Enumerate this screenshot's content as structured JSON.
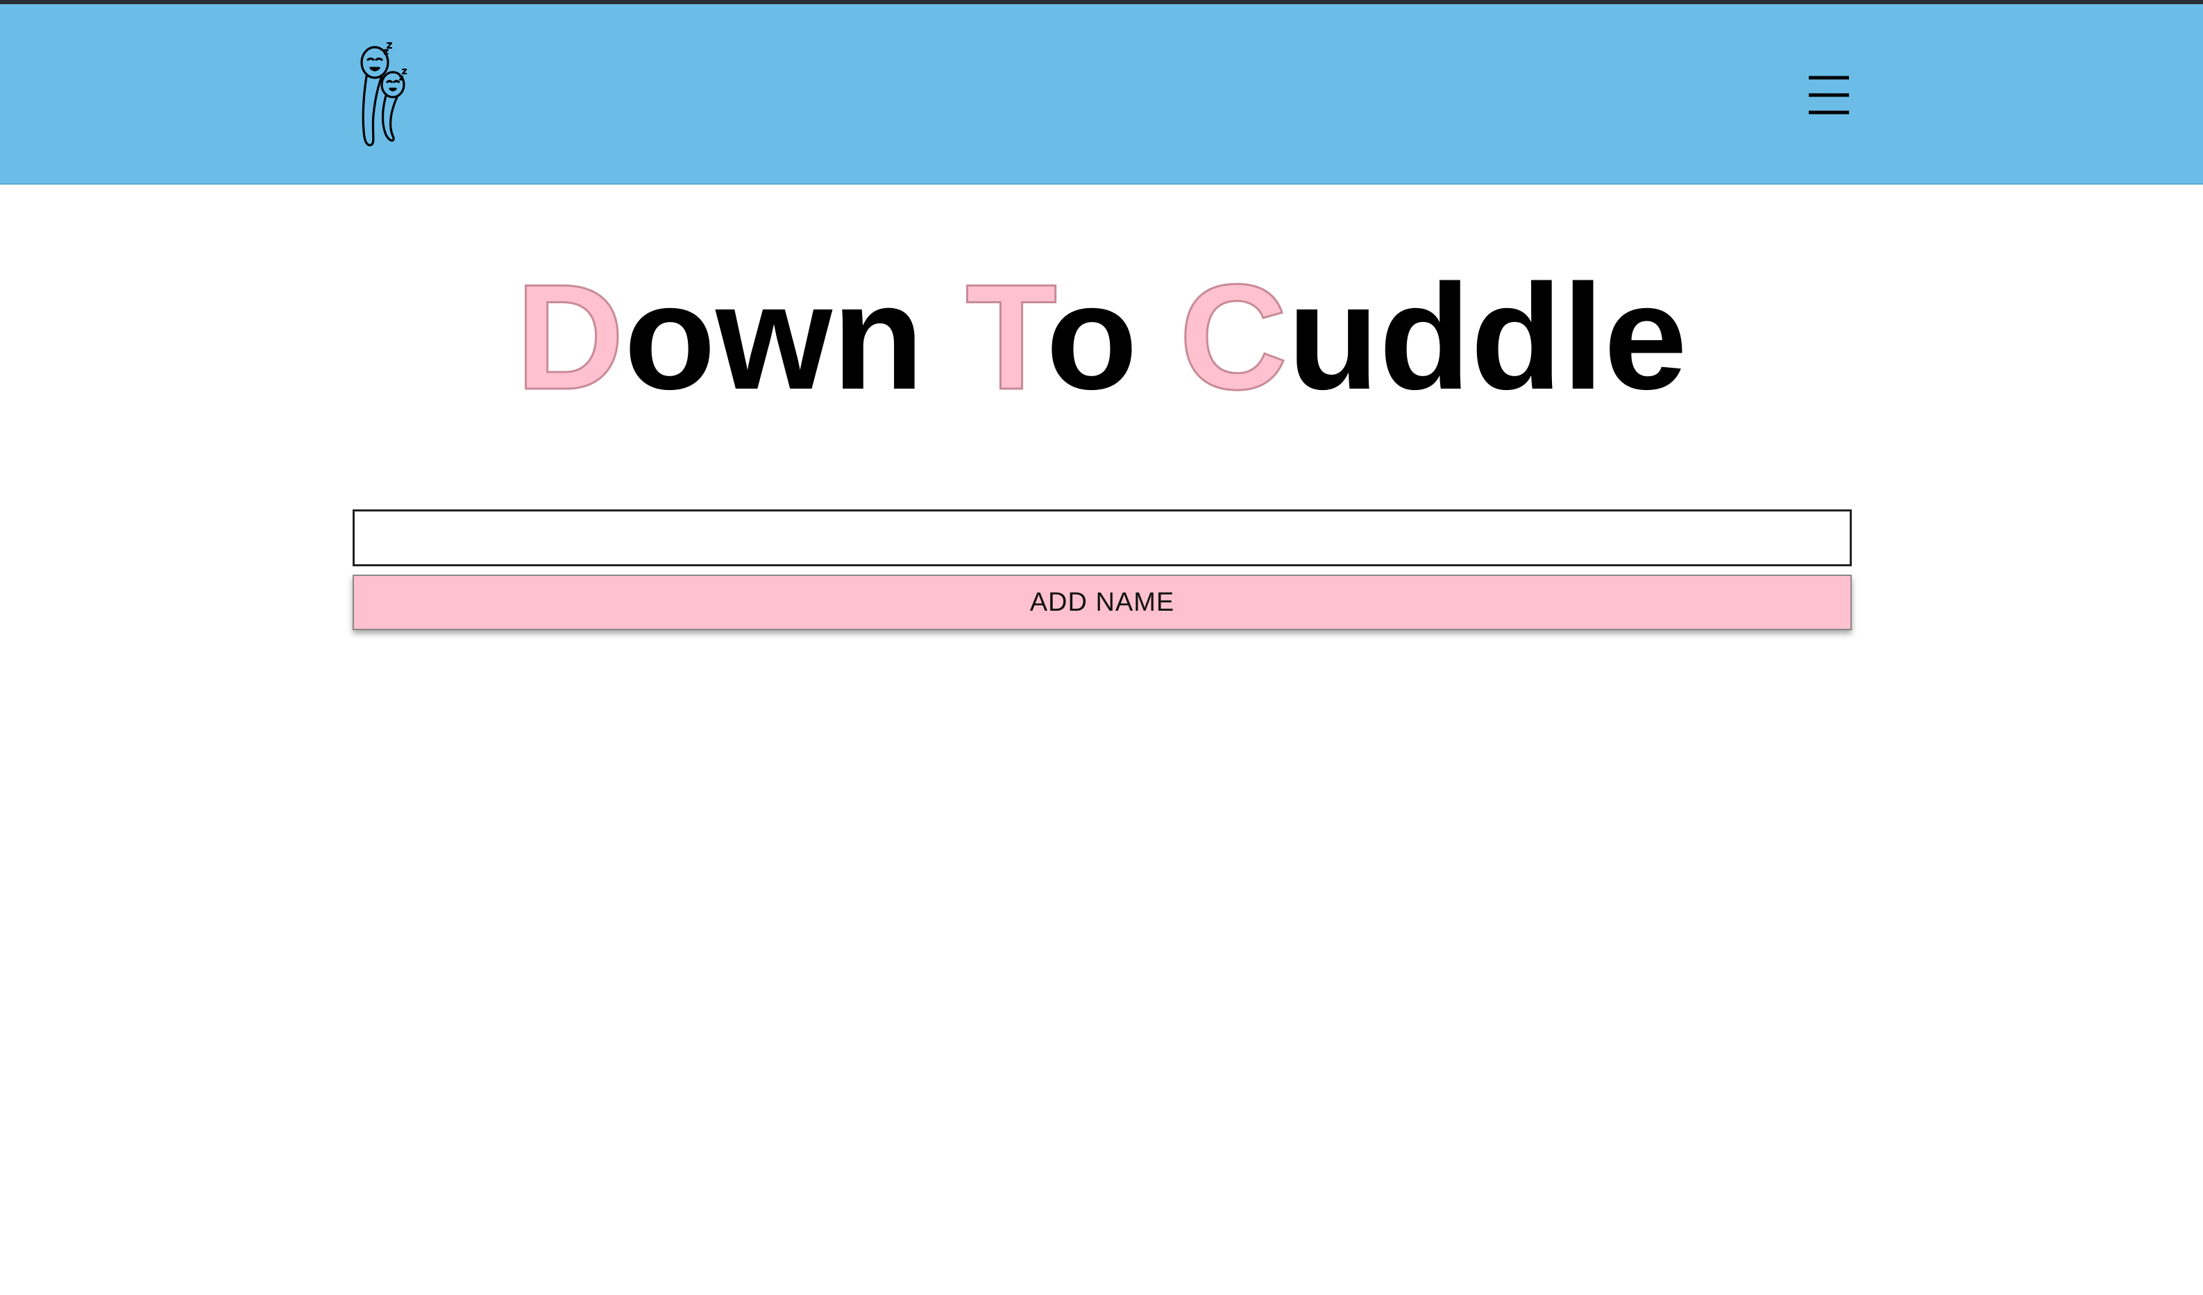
{
  "header": {
    "background_color": "#6bbde8",
    "logo_icon": "cuddling-spoons-logo-icon",
    "menu_icon": "hamburger-menu-icon"
  },
  "title": {
    "words": [
      {
        "first": "D",
        "rest": "own"
      },
      {
        "first": "T",
        "rest": "o"
      },
      {
        "first": "C",
        "rest": "uddle"
      }
    ],
    "accent_color": "#ffc1cf"
  },
  "form": {
    "name_value": "",
    "name_placeholder": "",
    "add_button_label": "ADD NAME",
    "button_color": "#ffc1cf"
  }
}
